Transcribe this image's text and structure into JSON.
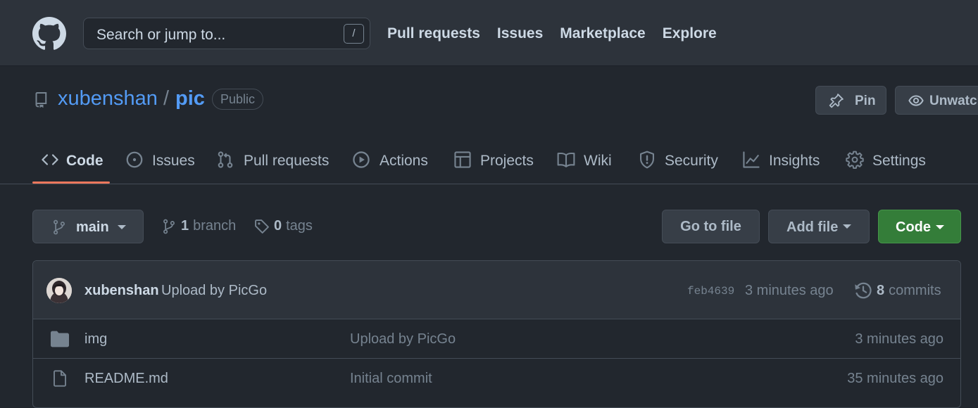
{
  "header": {
    "search_placeholder": "Search or jump to...",
    "search_shortcut": "/",
    "nav": [
      "Pull requests",
      "Issues",
      "Marketplace",
      "Explore"
    ]
  },
  "repo": {
    "owner": "xubenshan",
    "separator": "/",
    "name": "pic",
    "visibility": "Public",
    "pin_label": "Pin",
    "unwatch_label": "Unwatch"
  },
  "tabs": [
    {
      "label": "Code",
      "icon": "code-icon",
      "selected": true
    },
    {
      "label": "Issues",
      "icon": "issue-icon"
    },
    {
      "label": "Pull requests",
      "icon": "pull-request-icon"
    },
    {
      "label": "Actions",
      "icon": "play-icon"
    },
    {
      "label": "Projects",
      "icon": "table-icon"
    },
    {
      "label": "Wiki",
      "icon": "book-icon"
    },
    {
      "label": "Security",
      "icon": "shield-icon"
    },
    {
      "label": "Insights",
      "icon": "graph-icon"
    },
    {
      "label": "Settings",
      "icon": "gear-icon"
    }
  ],
  "file_nav": {
    "branch": "main",
    "branch_count": "1",
    "branch_word": "branch",
    "tag_count": "0",
    "tag_word": "tags",
    "go_to_file": "Go to file",
    "add_file": "Add file",
    "code": "Code"
  },
  "latest_commit": {
    "author": "xubenshan",
    "message": "Upload by PicGo",
    "sha": "feb4639",
    "time": "3 minutes ago",
    "commit_count": "8",
    "commit_word": "commits"
  },
  "files": [
    {
      "type": "folder",
      "name": "img",
      "message": "Upload by PicGo",
      "time": "3 minutes ago"
    },
    {
      "type": "file",
      "name": "README.md",
      "message": "Initial commit",
      "time": "35 minutes ago"
    }
  ],
  "colors": {
    "background": "#22272e",
    "header_bg": "#2d333b",
    "link": "#539bf5",
    "tab_underline": "#ec775c",
    "code_button": "#347d39"
  }
}
